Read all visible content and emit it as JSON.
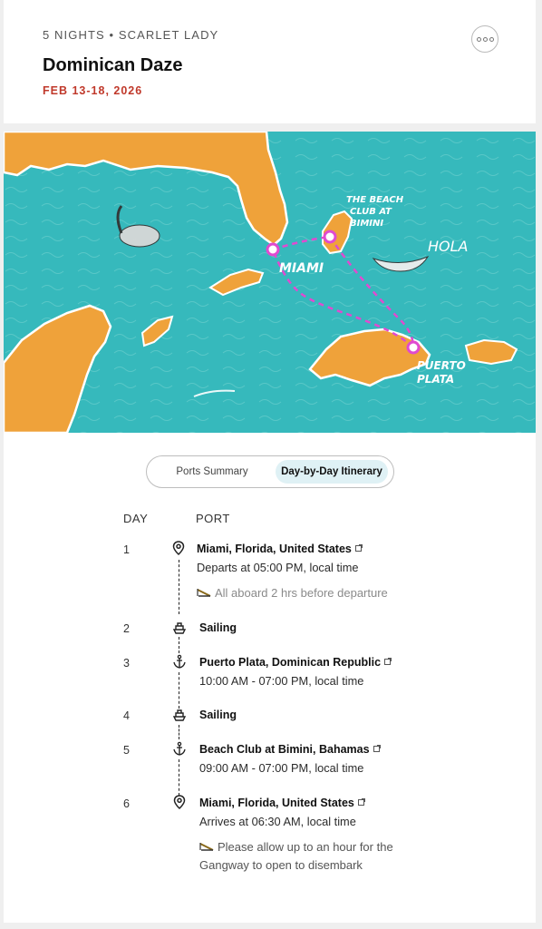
{
  "header": {
    "eyebrow": "5 NIGHTS • SCARLET LADY",
    "title": "Dominican Daze",
    "dates": "FEB 13-18, 2026",
    "more_icon": "ellipsis-icon"
  },
  "map": {
    "labels": {
      "miami": "MIAMI",
      "bimini_line1": "THE BEACH",
      "bimini_line2": "CLUB AT",
      "bimini_line3": "BIMINI",
      "hola": "HOLA",
      "puerto_line1": "PUERTO",
      "puerto_line2": "PLATA"
    },
    "colors": {
      "sea": "#36b9bc",
      "land": "#efa23a",
      "route": "#e04ad0"
    }
  },
  "tabs": {
    "ports_summary": "Ports Summary",
    "day_by_day": "Day-by-Day Itinerary",
    "active": "Day-by-Day Itinerary"
  },
  "itinerary": {
    "day_header": "DAY",
    "port_header": "PORT",
    "days": [
      {
        "day": "1",
        "icon": "map-pin-icon",
        "port": "Miami, Florida, United States",
        "detail": "Departs at 05:00 PM, local time",
        "note": "All aboard 2 hrs before departure"
      },
      {
        "day": "2",
        "icon": "ship-icon",
        "port": "Sailing"
      },
      {
        "day": "3",
        "icon": "anchor-icon",
        "port": "Puerto Plata, Dominican Republic",
        "detail": "10:00 AM - 07:00 PM, local time"
      },
      {
        "day": "4",
        "icon": "ship-icon",
        "port": "Sailing"
      },
      {
        "day": "5",
        "icon": "anchor-icon",
        "port": "Beach Club at Bimini, Bahamas",
        "detail": "09:00 AM - 07:00 PM, local time"
      },
      {
        "day": "6",
        "icon": "map-pin-icon",
        "port": "Miami, Florida, United States",
        "detail": "Arrives at 06:30 AM, local time",
        "note_line1": "Please allow up to an hour for the",
        "note_line2": "Gangway to open to disembark"
      }
    ]
  }
}
